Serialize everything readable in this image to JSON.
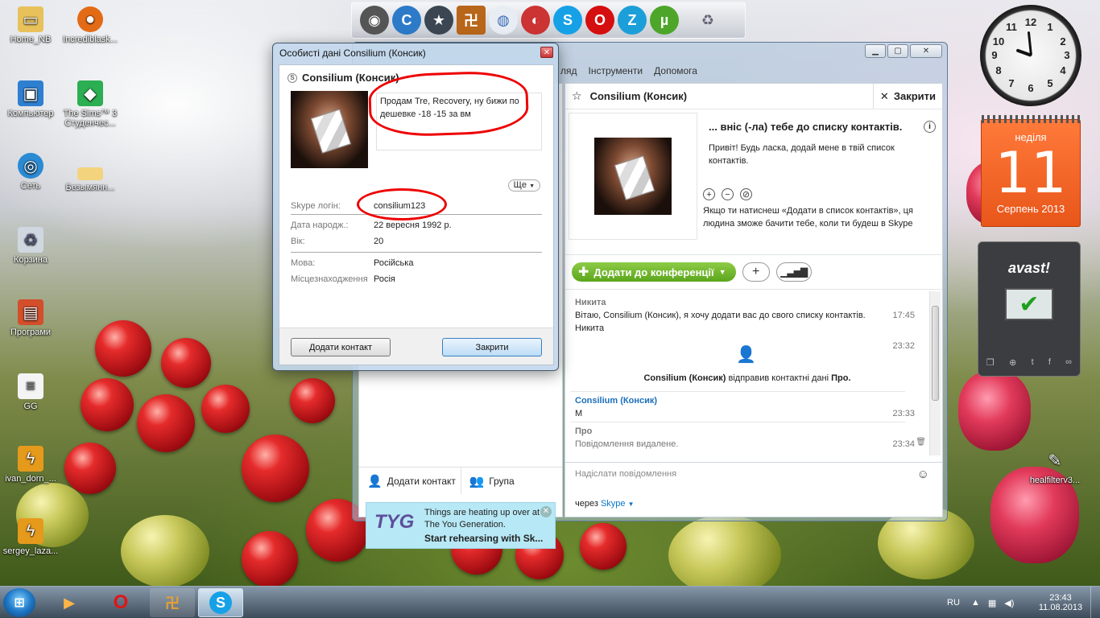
{
  "desktop": {
    "icons": [
      {
        "label": "Home_NB",
        "icon": "folder-icon"
      },
      {
        "label": "Incrediblask...",
        "icon": "basketball-icon"
      },
      {
        "label": "Компьютер",
        "icon": "computer-icon"
      },
      {
        "label": "The Sims™ 3 Студенчес...",
        "icon": "sims-icon"
      },
      {
        "label": "Сеть",
        "icon": "network-icon"
      },
      {
        "label": "Безымянн...",
        "icon": "image-file-icon"
      },
      {
        "label": "Корзина",
        "icon": "recycle-bin-icon"
      },
      {
        "label": "Програми",
        "icon": "programs-folder-icon"
      },
      {
        "label": "GG",
        "icon": "text-file-icon"
      },
      {
        "label": "ivan_dorn_...",
        "icon": "winamp-file-icon"
      },
      {
        "label": "sergey_laza...",
        "icon": "winamp-file-icon"
      },
      {
        "label": "healfilterv3...",
        "icon": "pen-file-icon"
      }
    ]
  },
  "gadgets": {
    "calendar": {
      "weekday": "неділя",
      "day": "11",
      "month_year": "Серпень 2013"
    },
    "avast": {
      "brand": "avast!"
    },
    "clock": {
      "numbers": [
        "12",
        "1",
        "2",
        "3",
        "4",
        "5",
        "6",
        "7",
        "8",
        "9",
        "10",
        "11"
      ]
    }
  },
  "skype": {
    "menu": [
      "ляд",
      "Інструменти",
      "Допомога"
    ],
    "contact_header": {
      "name": "Consilium (Консик)",
      "close_label": "Закрити"
    },
    "request": {
      "title": "... вніс (-ла) тебе до списку контактів.",
      "text": "Привіт! Будь ласка, додай мене в твій список контактів.",
      "note": "Якщо ти натиснеш «Додати в список контактів», ця людина зможе бачити тебе, коли ти будеш в Skype"
    },
    "conference_button": "Додати до конференції",
    "messages": [
      {
        "name": "Никита",
        "text": "Вітаю, Consilium (Консик), я хочу додати вас до свого списку контактів.",
        "text2": "Никита",
        "time": "17:45"
      },
      {
        "time": "23:32",
        "system_name": "Consilium (Консик)",
        "system_text": "відправив контактні дані",
        "system_target": "Про."
      },
      {
        "name": "Consilium (Консик)",
        "text": "М",
        "time": "23:33"
      },
      {
        "name": "Про",
        "text": "Повідомлення видалене.",
        "time": "23:34"
      }
    ],
    "compose_placeholder": "Надіслати повідомлення",
    "via_label": "через",
    "via_service": "Skype",
    "left_actions": {
      "add_contact": "Додати контакт",
      "group": "Група"
    },
    "ad": {
      "logo": "TYG",
      "line1": "Things are heating up over at",
      "line2": "The You Generation.",
      "line3": "Start rehearsing with Sk..."
    }
  },
  "profile_dialog": {
    "title": "Особисті дані Consilium (Консик)",
    "name": "Consilium (Консик)",
    "mood": "Продам Tre, Recovery, ну бижи по дешевке -18 -15 за вм",
    "more_label": "Ще",
    "fields": [
      {
        "label": "Skype логін:",
        "value": "consilium123"
      },
      {
        "label": "Дата народж.:",
        "value": "22 вересня 1992 р."
      },
      {
        "label": "Вік:",
        "value": "20"
      },
      {
        "label": "Мова:",
        "value": "Російська"
      },
      {
        "label": "Місцезнаходження",
        "value": "Росія"
      }
    ],
    "add_contact_button": "Додати контакт",
    "close_button": "Закрити"
  },
  "taskbar": {
    "lang": "RU",
    "time": "23:43",
    "date": "11.08.2013"
  }
}
